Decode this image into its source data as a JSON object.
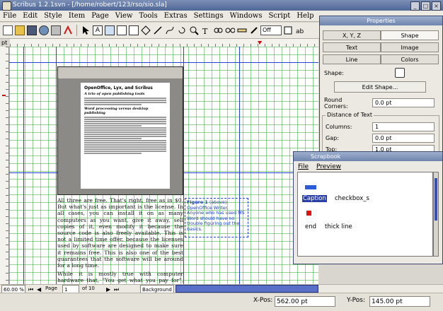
{
  "window": {
    "title": "Scribus 1.2.1svn - [/home/robert/123/rso/sio.sla]"
  },
  "menu": [
    "File",
    "Edit",
    "Style",
    "Item",
    "Page",
    "View",
    "Tools",
    "Extras",
    "Settings",
    "Windows",
    "Script",
    "Help"
  ],
  "toolbar": {
    "zoom_select": "Off"
  },
  "ruler": {
    "unit_label": "pt"
  },
  "document": {
    "image_title": "OpenOffice, Lyx, and Scribus",
    "image_subtitle": "A trio of open publishing tools",
    "image_subhead": "Word processing versus desktop publishing",
    "body_paragraphs": [
      "All three are free. That's right, free as in $0. But what's just as important is the license. In all cases, you can install it on as many computers as you want, give it away, sell copies of it, even modify it because the source code is also freely available. This is not a limited time offer, because the licenses used by software are designed to make sure it remains free. This is also one of the best guarantees that the software will be around for a long time.",
      "While it is mostly true with computer hardware that, \"You get what you pay for\", open source software is very different. Most of the time, with open source software, \"You get more than you paid for.\" In the case of the software packages mentioned, this is very true."
    ],
    "caption_label": "Figure 1",
    "caption_text": " (above): OpenOffice Writer. Anyone who has used MS Word should have no trouble figuring out the basics."
  },
  "status": {
    "zoom": "60.00 %",
    "page_label": "Page",
    "page_number": "1",
    "page_total": "of 10",
    "layer": "Background",
    "xpos_label": "X-Pos:",
    "xpos_value": "562.00 pt",
    "ypos_label": "Y-Pos:",
    "ypos_value": "145.00 pt"
  },
  "properties": {
    "title": "Properties",
    "tabs": [
      "X, Y, Z",
      "Shape",
      "Text",
      "Image",
      "Line",
      "Colors"
    ],
    "shape_label": "Shape:",
    "edit_shape": "Edit Shape...",
    "round_corners_label": "Round Corners:",
    "round_corners_value": "0.0 pt",
    "distance_group": "Distance of Text",
    "columns_label": "Columns:",
    "columns_value": "1",
    "gap_label": "Gap:",
    "gap_value": "0.0 pt",
    "top_label": "Top:",
    "top_value": "1.0 pt"
  },
  "scrapbook": {
    "title": "Scrapbook",
    "menu": [
      "File",
      "Preview"
    ],
    "items": [
      "Caption",
      "checkbox_s",
      "end",
      "thick line"
    ]
  }
}
